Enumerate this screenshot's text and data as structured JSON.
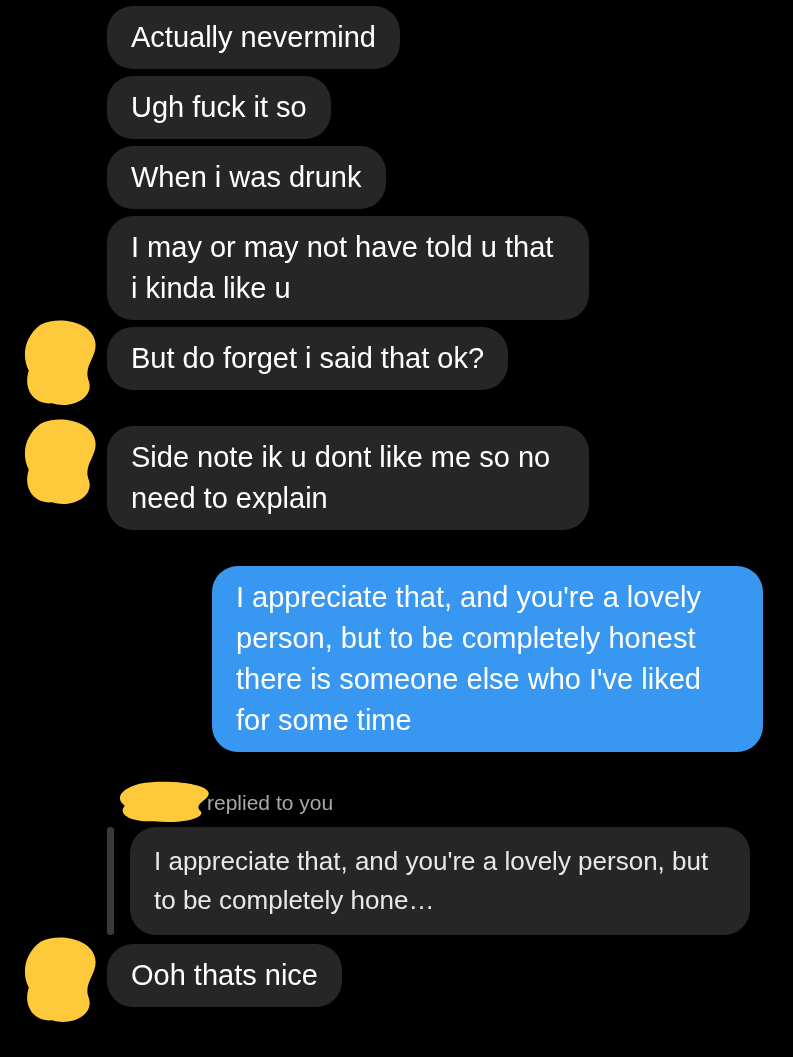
{
  "groups": [
    {
      "kind": "incoming",
      "avatar_redacted": true,
      "messages": [
        "Actually nevermind",
        "Ugh fuck it so",
        "When i was drunk",
        "I may or may not have told u that i kinda like u",
        "But do forget i said that ok?"
      ]
    },
    {
      "kind": "incoming",
      "avatar_redacted": true,
      "messages": [
        "Side note ik u dont like me so no need to explain"
      ]
    },
    {
      "kind": "outgoing",
      "avatar_redacted": false,
      "messages": [
        "I appreciate that, and you're a lovely person, but to be completely honest there is someone else who I've liked for some time"
      ]
    },
    {
      "kind": "reply",
      "avatar_redacted": true,
      "sender_redacted": true,
      "reply_label": "replied to you",
      "quote": "I appreciate that, and you're a lovely person, but to be completely hone…",
      "messages": [
        "Ooh thats nice"
      ]
    }
  ]
}
